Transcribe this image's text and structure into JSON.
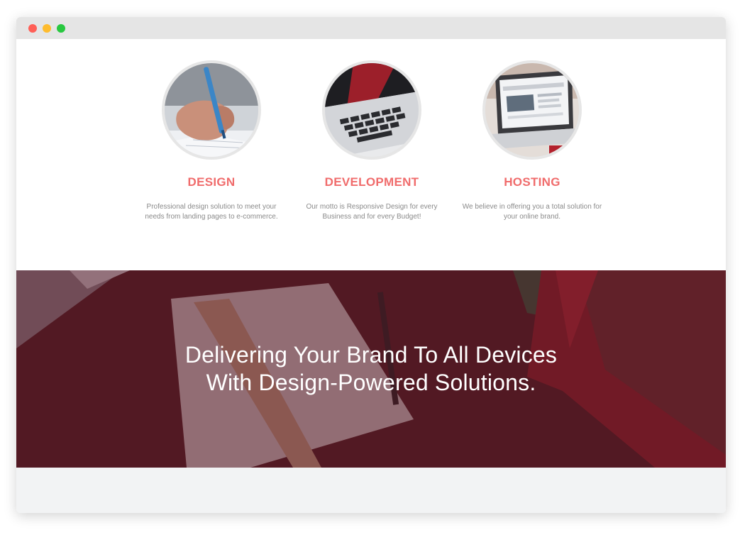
{
  "services": [
    {
      "title": "DESIGN",
      "desc_line1": "Professional design solution to meet your",
      "desc_line2": "needs from landing pages to e-commerce."
    },
    {
      "title": "DEVELOPMENT",
      "desc_line1": "Our motto is Responsive Design for every",
      "desc_line2": "Business and for every Budget!"
    },
    {
      "title": "HOSTING",
      "desc_line1": "We believe in offering you a total solution for",
      "desc_line2": "your online brand."
    }
  ],
  "hero": {
    "line1": "Delivering Your Brand To All Devices",
    "line2": "With Design-Powered Solutions."
  },
  "colors": {
    "accent": "#f06c6c",
    "hero_overlay": "#5a1a24",
    "window_chrome": "#e5e5e5"
  }
}
